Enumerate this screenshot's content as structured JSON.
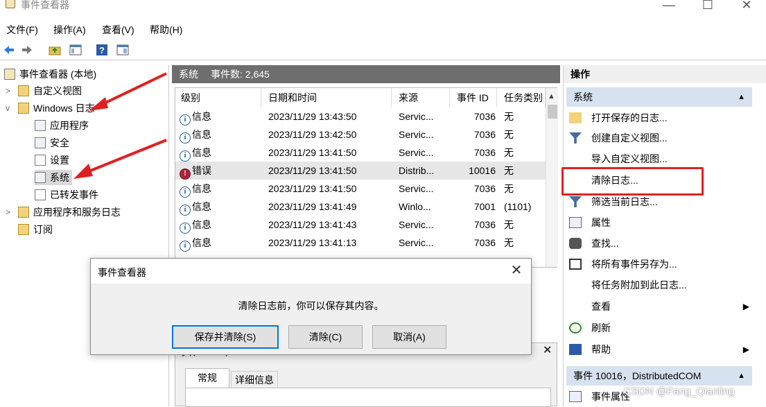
{
  "window": {
    "title": "事件查看器",
    "min": "—",
    "max": "☐",
    "close": "✕"
  },
  "menu": [
    "文件(F)",
    "操作(A)",
    "查看(V)",
    "帮助(H)"
  ],
  "tree": {
    "root": "事件查看器 (本地)",
    "custom_views": "自定义视图",
    "windows_logs": "Windows 日志",
    "app": "应用程序",
    "security": "安全",
    "setup": "设置",
    "system": "系统",
    "forwarded": "已转发事件",
    "app_service_logs": "应用程序和服务日志",
    "subscriptions": "订阅"
  },
  "center": {
    "header_name": "系统",
    "header_count": "事件数: 2,645",
    "columns": [
      "级别",
      "日期和时间",
      "来源",
      "事件 ID",
      "任务类别"
    ],
    "rows": [
      {
        "level": "信息",
        "date": "2023/11/29 13:43:50",
        "source": "Servic...",
        "id": "7036",
        "task": "无"
      },
      {
        "level": "信息",
        "date": "2023/11/29 13:42:50",
        "source": "Servic...",
        "id": "7036",
        "task": "无"
      },
      {
        "level": "信息",
        "date": "2023/11/29 13:41:50",
        "source": "Servic...",
        "id": "7036",
        "task": "无"
      },
      {
        "level": "错误",
        "date": "2023/11/29 13:41:50",
        "source": "Distrib...",
        "id": "10016",
        "task": "无"
      },
      {
        "level": "信息",
        "date": "2023/11/29 13:41:50",
        "source": "Servic...",
        "id": "7036",
        "task": "无"
      },
      {
        "level": "信息",
        "date": "2023/11/29 13:41:49",
        "source": "Winlo...",
        "id": "7001",
        "task": "(1101)"
      },
      {
        "level": "信息",
        "date": "2023/11/29 13:41:43",
        "source": "Servic...",
        "id": "7036",
        "task": "无"
      },
      {
        "level": "信息",
        "date": "2023/11/29 13:41:13",
        "source": "Servic...",
        "id": "7036",
        "task": "无"
      }
    ],
    "detail_title": "事件 10016, DistributedCOM",
    "detail_tabs": [
      "常规",
      "详细信息"
    ]
  },
  "actions": {
    "header": "操作",
    "section_system": "系统",
    "items": {
      "open_saved": "打开保存的日志...",
      "create_view": "创建自定义视图...",
      "import_view": "导入自定义视图...",
      "clear_log": "清除日志...",
      "filter": "筛选当前日志...",
      "properties": "属性",
      "find": "查找...",
      "save_all": "将所有事件另存为...",
      "attach_task": "将任务附加到此日志...",
      "view": "查看",
      "refresh": "刷新",
      "help": "帮助"
    },
    "section_event": "事件 10016，DistributedCOM",
    "event_props": "事件属性"
  },
  "dialog": {
    "title": "事件查看器",
    "message": "清除日志前，你可以保存其内容。",
    "save_clear": "保存并清除(S)",
    "clear": "清除(C)",
    "cancel": "取消(A)"
  },
  "watermark": "CSDN @Fang_Qianling",
  "colors": {
    "annotation": "#e02020",
    "section": "#d6e2f0",
    "error": "#a8263a"
  }
}
